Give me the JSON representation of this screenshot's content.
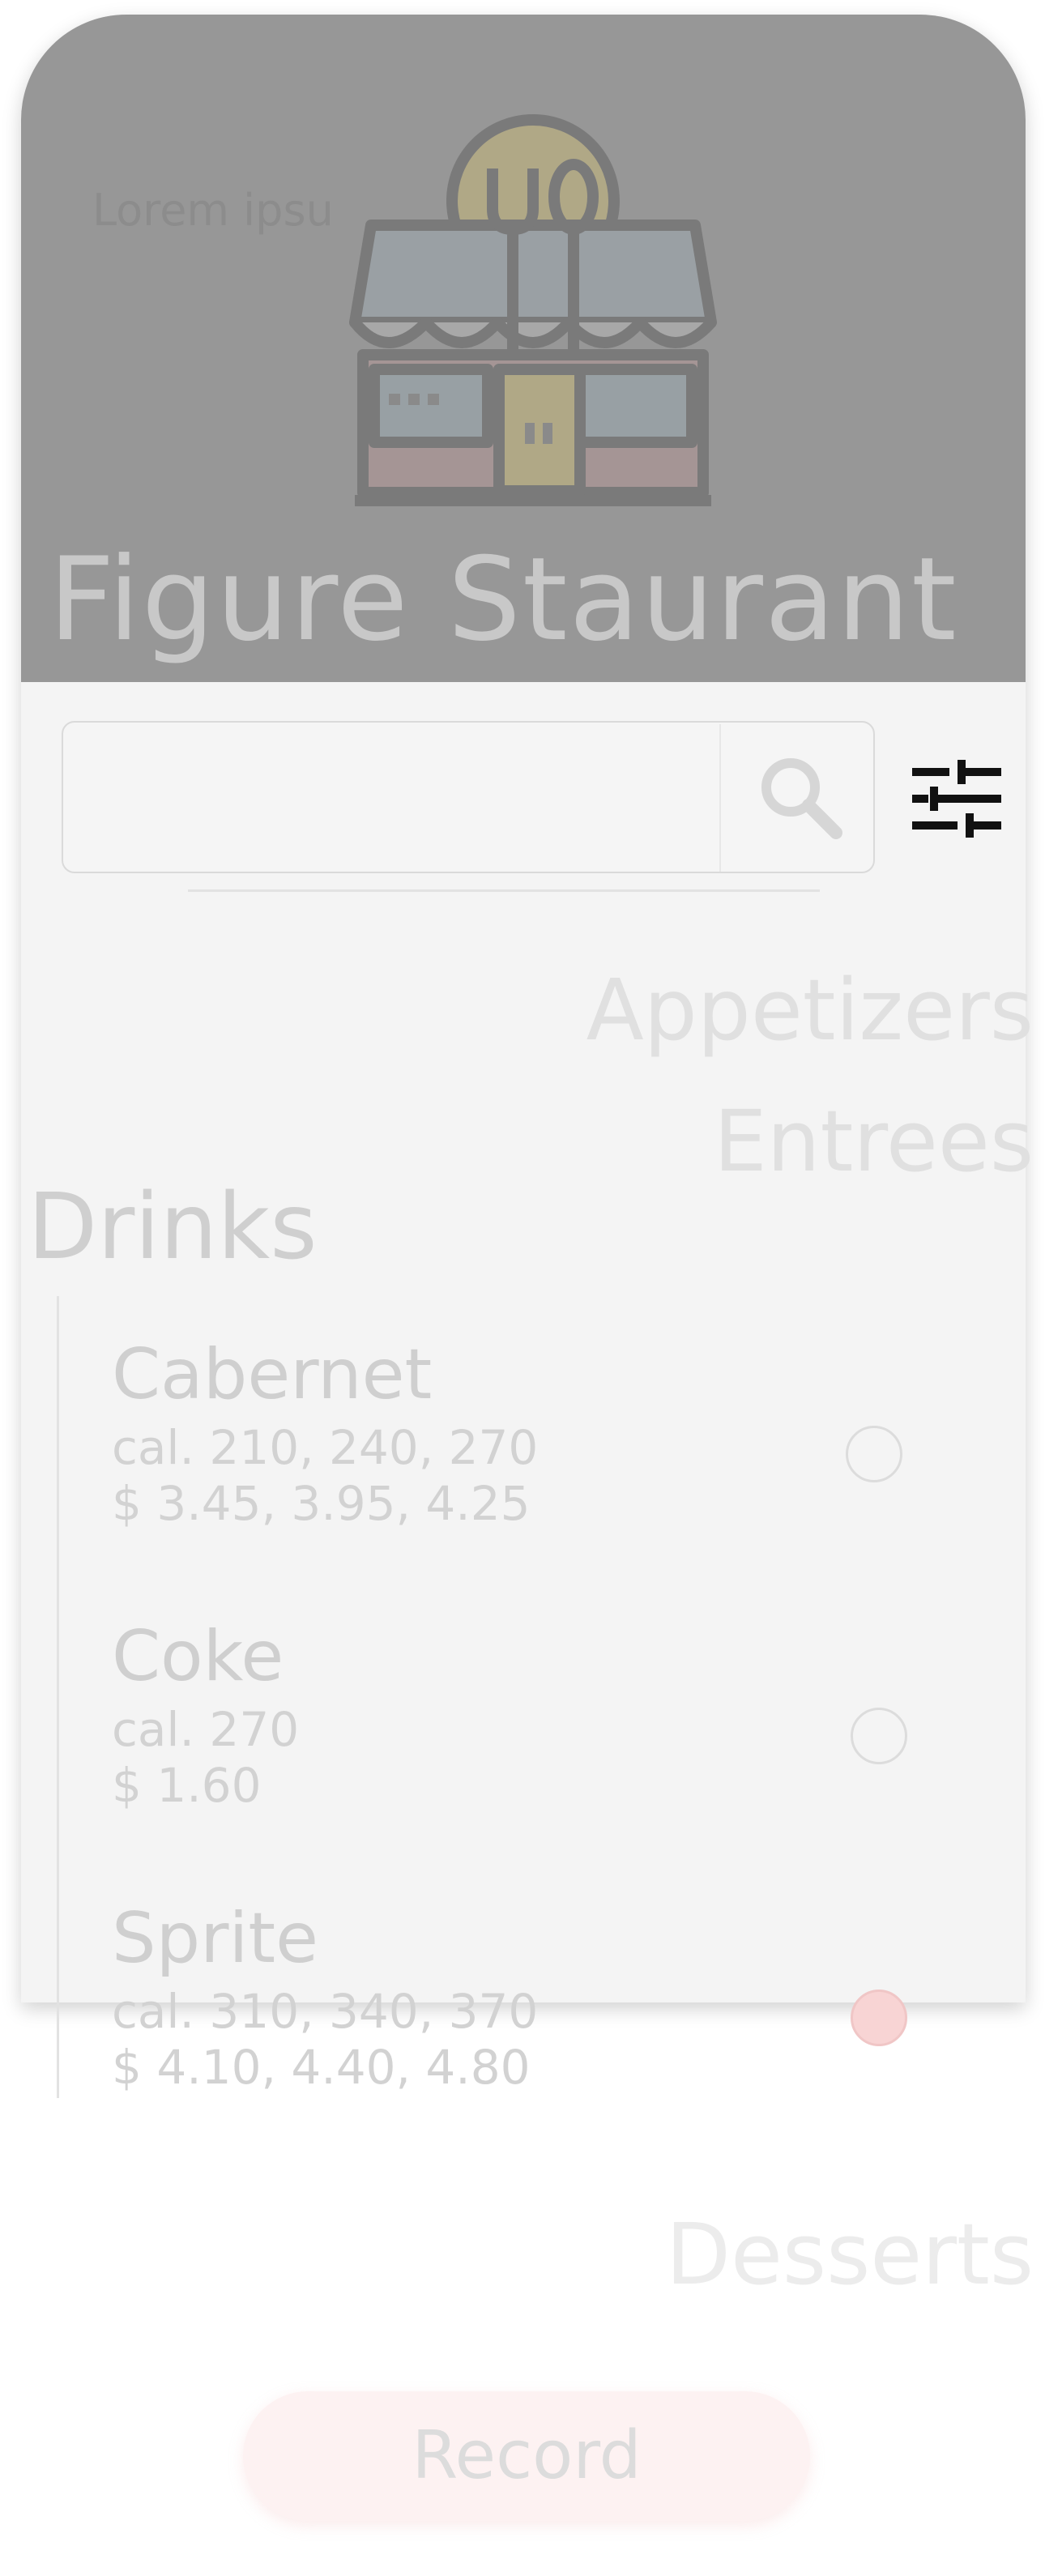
{
  "header": {
    "lorem": "Lorem ipsu",
    "brand_name": "Figure Staurant"
  },
  "search": {
    "value": "",
    "placeholder": ""
  },
  "categories": [
    {
      "label": "Appetizers"
    },
    {
      "label": "Entrees"
    },
    {
      "label": "Drinks"
    },
    {
      "label": "Desserts"
    }
  ],
  "drinks": [
    {
      "name": "Cabernet",
      "calories": "cal. 210, 240, 270",
      "price": "$ 3.45, 3.95, 4.25",
      "selected": false
    },
    {
      "name": "Coke",
      "calories": "cal. 270",
      "price": "$ 1.60",
      "selected": false
    },
    {
      "name": "Sprite",
      "calories": "cal. 310, 340, 370",
      "price": "$ 4.10, 4.40, 4.80",
      "selected": true
    }
  ],
  "actions": {
    "record_label": "Record"
  },
  "colors": {
    "hero_bg": "#979797",
    "selected_radio": "#f8d4d4",
    "record_bg": "#fdf2f2"
  },
  "icons": [
    "storefront-icon",
    "search-icon",
    "filter-sliders-icon"
  ]
}
